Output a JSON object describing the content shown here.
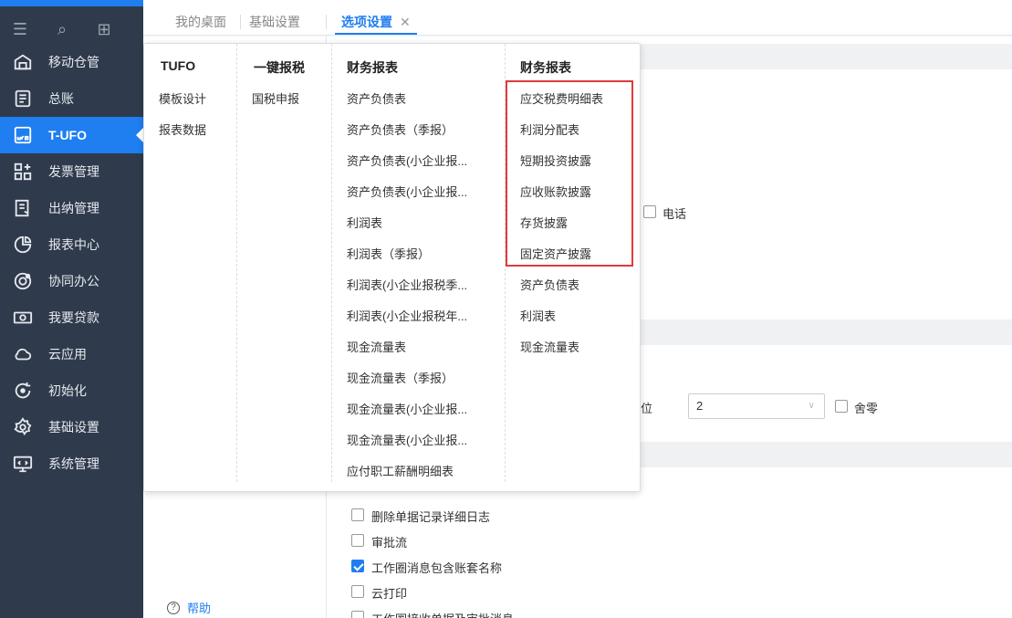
{
  "sidebar": {
    "items": [
      {
        "label": "移动仓管",
        "icon": "warehouse-icon"
      },
      {
        "label": "总账",
        "icon": "ledger-icon"
      },
      {
        "label": "T-UFO",
        "icon": "ufo-icon",
        "active": true
      },
      {
        "label": "发票管理",
        "icon": "invoice-icon"
      },
      {
        "label": "出纳管理",
        "icon": "cashier-icon"
      },
      {
        "label": "报表中心",
        "icon": "report-icon"
      },
      {
        "label": "协同办公",
        "icon": "collaboration-icon"
      },
      {
        "label": "我要贷款",
        "icon": "loan-icon"
      },
      {
        "label": "云应用",
        "icon": "cloud-icon"
      },
      {
        "label": "初始化",
        "icon": "init-icon"
      },
      {
        "label": "基础设置",
        "icon": "settings-icon"
      },
      {
        "label": "系统管理",
        "icon": "system-icon"
      }
    ]
  },
  "tabs": [
    {
      "label": "我的桌面"
    },
    {
      "label": "基础设置"
    },
    {
      "label": "选项设置",
      "active": true
    }
  ],
  "background": {
    "phone_label": "电话",
    "decimal_label": "位",
    "decimal_value": "2",
    "round_label": "舍零",
    "options": [
      {
        "label": "删除单据记录详细日志",
        "checked": false
      },
      {
        "label": "审批流",
        "checked": false
      },
      {
        "label": "工作圈消息包含账套名称",
        "checked": true
      },
      {
        "label": "云打印",
        "checked": false
      },
      {
        "label": "工作圈接收单据及审批消息",
        "checked": false
      }
    ],
    "help_label": "帮助"
  },
  "menu": {
    "col1": {
      "head": "TUFO",
      "items": [
        "模板设计",
        "报表数据"
      ]
    },
    "col2": {
      "head": "一键报税",
      "items": [
        "国税申报"
      ]
    },
    "col3": {
      "head": "财务报表",
      "items": [
        "资产负债表",
        "资产负债表（季报）",
        "资产负债表(小企业报...",
        "资产负债表(小企业报...",
        "利润表",
        "利润表（季报）",
        "利润表(小企业报税季...",
        "利润表(小企业报税年...",
        "现金流量表",
        "现金流量表（季报）",
        "现金流量表(小企业报...",
        "现金流量表(小企业报...",
        "应付职工薪酬明细表"
      ]
    },
    "col4": {
      "head": "财务报表",
      "items": [
        "应交税费明细表",
        "利润分配表",
        "短期投资披露",
        "应收账款披露",
        "存货披露",
        "固定资产披露",
        "资产负债表",
        "利润表",
        "现金流量表"
      ]
    }
  },
  "colors": {
    "sidebar_bg": "#2f3b4c",
    "accent": "#1f7ef0",
    "highlight": "#e03a3a"
  }
}
